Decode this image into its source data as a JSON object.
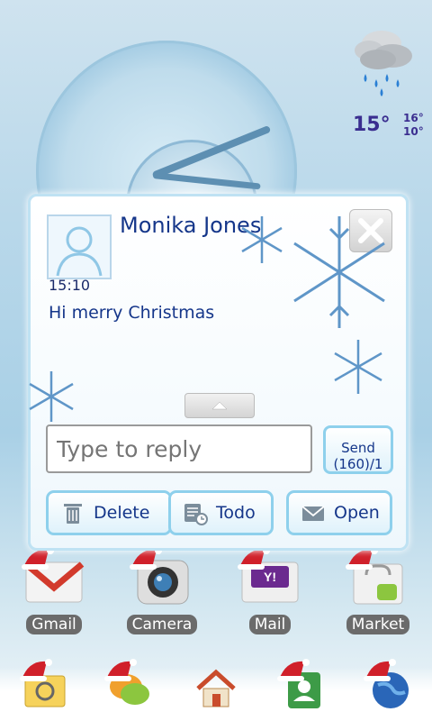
{
  "weather": {
    "current_temp": "15°",
    "high_temp": "16°",
    "low_temp": "10°",
    "condition_icon": "cloud-rain-icon"
  },
  "popup": {
    "contact_name": "Monika Jones",
    "time": "15:10",
    "message": "Hi merry Christmas",
    "reply_placeholder": "Type to reply",
    "send_label": "Send",
    "send_counter": "(160)/1",
    "buttons": {
      "delete": "Delete",
      "todo": "Todo",
      "open": "Open"
    }
  },
  "home_apps": [
    {
      "label": "Gmail",
      "icon": "gmail-icon"
    },
    {
      "label": "Camera",
      "icon": "camera-icon"
    },
    {
      "label": "Mail",
      "icon": "yahoo-mail-icon"
    },
    {
      "label": "Market",
      "icon": "android-market-icon"
    }
  ],
  "dock_apps": [
    {
      "icon": "email-icon"
    },
    {
      "icon": "chat-icon"
    },
    {
      "icon": "home-icon"
    },
    {
      "icon": "contacts-icon"
    },
    {
      "icon": "browser-globe-icon"
    }
  ],
  "colors": {
    "accent_blue": "#15368a",
    "button_border": "#8ed0ec",
    "temp_color": "#3a2d8f"
  }
}
